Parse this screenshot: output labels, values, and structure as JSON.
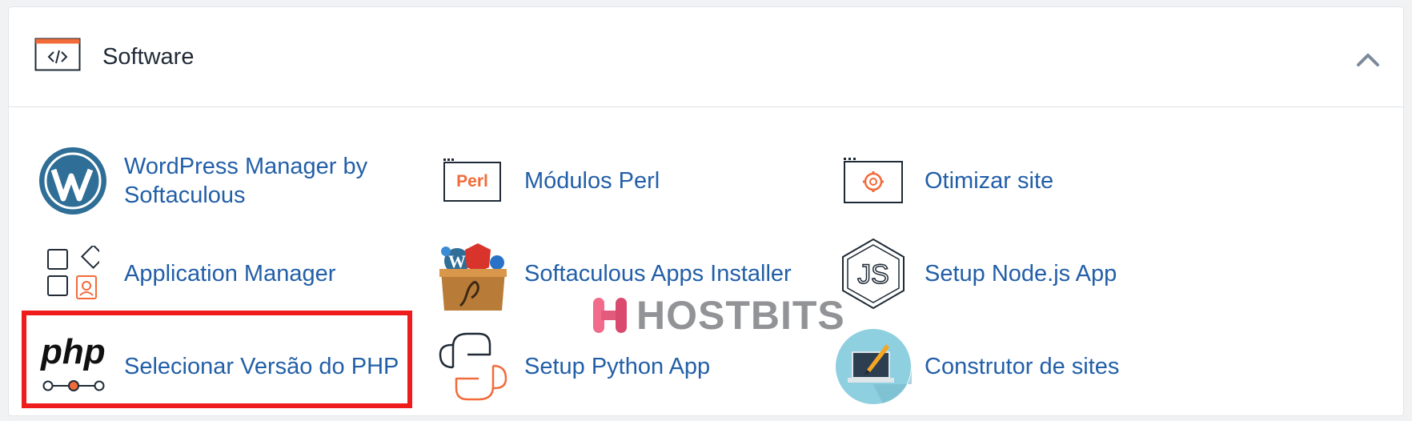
{
  "section": {
    "title": "Software",
    "icon": "code-window-icon",
    "collapse_icon": "chevron-up-icon"
  },
  "items": [
    {
      "label": "WordPress Manager by Softaculous",
      "icon": "wordpress-icon"
    },
    {
      "label": "Módulos Perl",
      "icon": "perl-icon",
      "icon_text": "Perl"
    },
    {
      "label": "Otimizar site",
      "icon": "gear-window-icon"
    },
    {
      "label": "Application Manager",
      "icon": "app-manager-icon"
    },
    {
      "label": "Softaculous Apps Installer",
      "icon": "softaculous-box-icon"
    },
    {
      "label": "Setup Node.js App",
      "icon": "nodejs-icon",
      "icon_text": "JS"
    },
    {
      "label": "Selecionar Versão do PHP",
      "icon": "php-icon",
      "icon_text": "php"
    },
    {
      "label": "Setup Python App",
      "icon": "python-icon"
    },
    {
      "label": "Construtor de sites",
      "icon": "site-builder-icon"
    }
  ],
  "watermark": {
    "text": "HOSTBITS"
  },
  "colors": {
    "link": "#225fa8",
    "accent_orange": "#f26b3a",
    "highlight_red": "#ee1c1c",
    "header_text": "#1f2a36"
  }
}
